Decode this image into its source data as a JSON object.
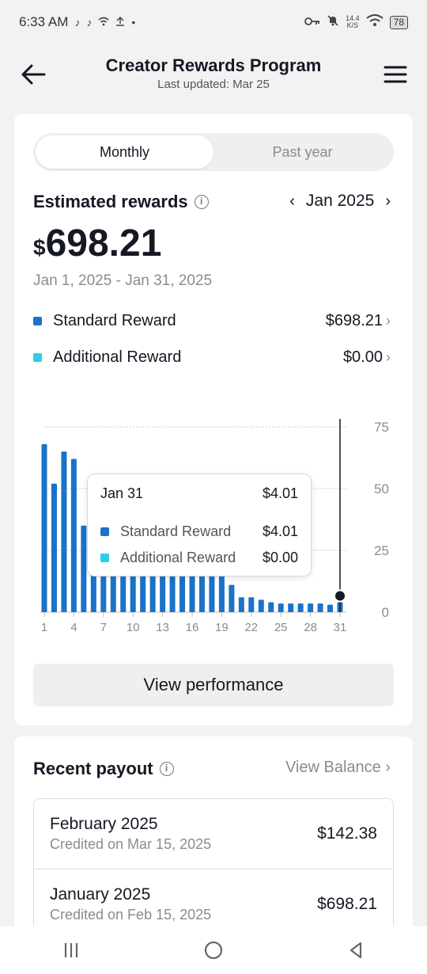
{
  "status_bar": {
    "time": "6:33 AM",
    "net_speed_value": "14.4",
    "net_speed_unit": "K/S",
    "battery": "78"
  },
  "header": {
    "title": "Creator Rewards Program",
    "subtitle": "Last updated: Mar 25"
  },
  "tabs": [
    {
      "label": "Monthly",
      "active": true
    },
    {
      "label": "Past year",
      "active": false
    }
  ],
  "estimated": {
    "title": "Estimated rewards",
    "month": "Jan 2025",
    "currency": "$",
    "amount": "698.21",
    "date_range": "Jan 1, 2025 - Jan 31, 2025"
  },
  "legend": [
    {
      "label": "Standard Reward",
      "value": "$698.21",
      "color": "#1a73c8"
    },
    {
      "label": "Additional Reward",
      "value": "$0.00",
      "color": "#2ccfe6"
    }
  ],
  "tooltip": {
    "date": "Jan 31",
    "total": "$4.01",
    "rows": [
      {
        "label": "Standard Reward",
        "value": "$4.01"
      },
      {
        "label": "Additional Reward",
        "value": "$0.00"
      }
    ]
  },
  "chart_data": {
    "type": "bar",
    "x": [
      1,
      2,
      3,
      4,
      5,
      6,
      7,
      8,
      9,
      10,
      11,
      12,
      13,
      14,
      15,
      16,
      17,
      18,
      19,
      20,
      21,
      22,
      23,
      24,
      25,
      26,
      27,
      28,
      29,
      30,
      31
    ],
    "x_tick_labels": [
      "1",
      "4",
      "7",
      "10",
      "13",
      "16",
      "19",
      "22",
      "25",
      "28",
      "31"
    ],
    "y_tick_labels": [
      "75",
      "50",
      "25",
      "0"
    ],
    "ylim": [
      0,
      75
    ],
    "series": [
      {
        "name": "Standard Reward",
        "color": "#1a73c8",
        "values": [
          68,
          52,
          65,
          62,
          35,
          33,
          38,
          30,
          28,
          29,
          29,
          30,
          27,
          26,
          28,
          29,
          28,
          30,
          27,
          11,
          6,
          6,
          5,
          4,
          3.5,
          3.5,
          3.5,
          3.5,
          3.5,
          3,
          4.01
        ]
      },
      {
        "name": "Additional Reward",
        "color": "#2ccfe6",
        "values": [
          0,
          0,
          0,
          0,
          0,
          0,
          0,
          0,
          0,
          0,
          0,
          0,
          0,
          0,
          0,
          0,
          0,
          0,
          0,
          0,
          0,
          0,
          0,
          0,
          0,
          0,
          0,
          0,
          0,
          0,
          0
        ]
      }
    ],
    "highlight_index": 30
  },
  "view_performance_label": "View performance",
  "payout": {
    "title": "Recent payout",
    "view_balance": "View Balance",
    "items": [
      {
        "month": "February 2025",
        "credited": "Credited on Mar 15, 2025",
        "amount": "$142.38"
      },
      {
        "month": "January 2025",
        "credited": "Credited on Feb 15, 2025",
        "amount": "$698.21"
      }
    ]
  }
}
